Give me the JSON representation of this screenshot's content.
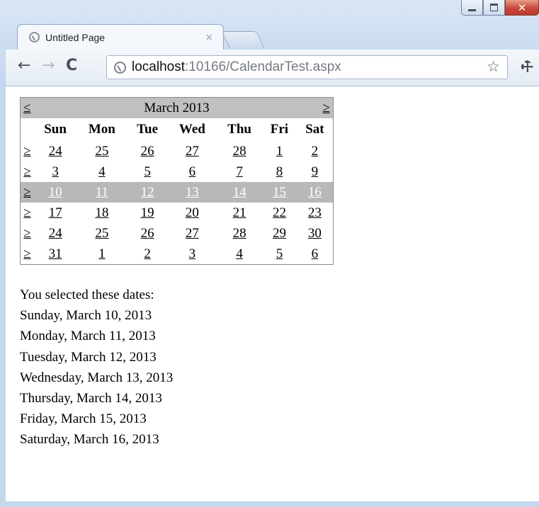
{
  "browser": {
    "tab_title": "Untitled Page",
    "tab_close": "×",
    "url_host": "localhost",
    "url_rest": ":10166/CalendarTest.aspx"
  },
  "calendar": {
    "prev": "≤",
    "next": "≥",
    "month_title": "March 2013",
    "days_of_week": [
      "Sun",
      "Mon",
      "Tue",
      "Wed",
      "Thu",
      "Fri",
      "Sat"
    ],
    "week_selector": "≥",
    "selected_week": 2,
    "weeks": [
      [
        "24",
        "25",
        "26",
        "27",
        "28",
        "1",
        "2"
      ],
      [
        "3",
        "4",
        "5",
        "6",
        "7",
        "8",
        "9"
      ],
      [
        "10",
        "11",
        "12",
        "13",
        "14",
        "15",
        "16"
      ],
      [
        "17",
        "18",
        "19",
        "20",
        "21",
        "22",
        "23"
      ],
      [
        "24",
        "25",
        "26",
        "27",
        "28",
        "29",
        "30"
      ],
      [
        "31",
        "1",
        "2",
        "3",
        "4",
        "5",
        "6"
      ]
    ]
  },
  "selection": {
    "heading": "You selected these dates:",
    "dates": [
      "Sunday, March 10, 2013",
      "Monday, March 11, 2013",
      "Tuesday, March 12, 2013",
      "Wednesday, March 13, 2013",
      "Thursday, March 14, 2013",
      "Friday, March 15, 2013",
      "Saturday, March 16, 2013"
    ]
  }
}
